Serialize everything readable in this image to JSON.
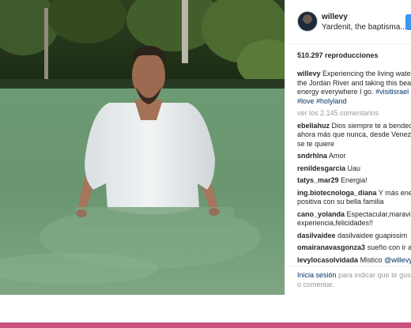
{
  "post": {
    "username": "willevy",
    "location": "Yardenit, the baptisma...",
    "views": "510.297 reproducciones",
    "caption": {
      "username": "willevy",
      "line1": "Experiencing the living wate",
      "line2": "the Jordan River and taking this bea",
      "line3_text": "energy everywhere I go. ",
      "line3_tag": "#visitisrael",
      "line4_tag1": "#love",
      "line4_tag2": "#holyland"
    },
    "view_comments": "ver los 2.145 comentarios",
    "comments": [
      {
        "user": "ebeliahuz",
        "lines": [
          "Dios siempre te a bended",
          "ahora más que nunca, desde Venez",
          "se te quiere"
        ]
      },
      {
        "user": "sndrhlna",
        "lines": [
          "Amor"
        ]
      },
      {
        "user": "renildesgarcia",
        "lines": [
          "Uau"
        ]
      },
      {
        "user": "tatys_mar29",
        "lines": [
          "Energia!"
        ]
      },
      {
        "user": "ing.biotecnologa_diana",
        "lines": [
          "Y más ener",
          "positiva con su bella familia"
        ]
      },
      {
        "user": "cano_yolanda",
        "lines": [
          "Espectacular,maravill",
          "experiencia,felicidades!!"
        ]
      },
      {
        "user": "dasilvaidee",
        "lines": [
          "dasilvaidee guapissim"
        ]
      },
      {
        "user": "omairanavasgonza3",
        "lines": [
          "sueño con ir al"
        ]
      },
      {
        "user": "levylocasolvidada",
        "lines": [
          "Mistico ",
          "@willevy"
        ]
      }
    ],
    "login": {
      "link": "Inicia sesión",
      "text_line1": " para indicar que te gus",
      "text_line2": "o comentar."
    }
  },
  "colors": {
    "accent_bar": "#c7507d",
    "link": "#003569",
    "follow_button": "#3897f0",
    "muted_text": "#999999"
  },
  "icons": {
    "avatar": "profile-avatar"
  }
}
